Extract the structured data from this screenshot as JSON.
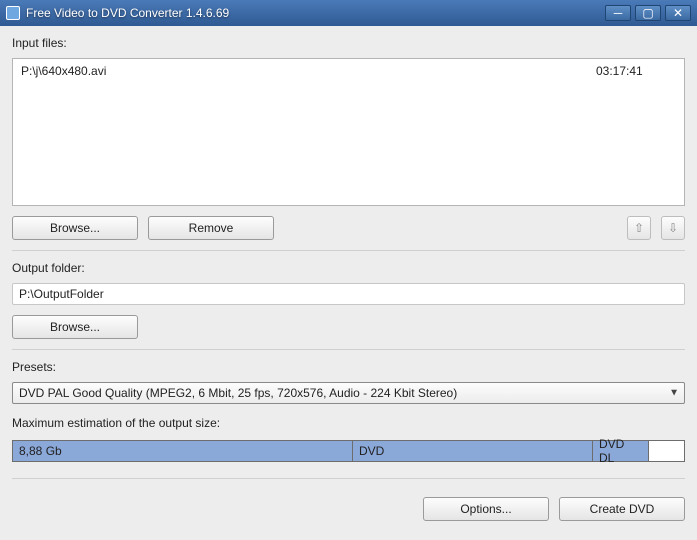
{
  "window": {
    "title": "Free Video to DVD Converter 1.4.6.69"
  },
  "labels": {
    "input_files": "Input files:",
    "output_folder": "Output folder:",
    "presets": "Presets:",
    "max_estimation": "Maximum estimation of the output size:"
  },
  "buttons": {
    "browse_input": "Browse...",
    "remove": "Remove",
    "browse_output": "Browse...",
    "options": "Options...",
    "create_dvd": "Create DVD"
  },
  "files": [
    {
      "path": "P:\\j\\640x480.avi",
      "duration": "03:17:41"
    }
  ],
  "output": {
    "path": "P:\\OutputFolder"
  },
  "presets": {
    "selected": "DVD PAL Good Quality (MPEG2, 6 Mbit, 25 fps, 720x576, Audio - 224 Kbit Stereo)"
  },
  "size_bar": {
    "estimate": "8,88 Gb",
    "marker_dvd": "DVD",
    "marker_dvd_dl": "DVD DL"
  }
}
